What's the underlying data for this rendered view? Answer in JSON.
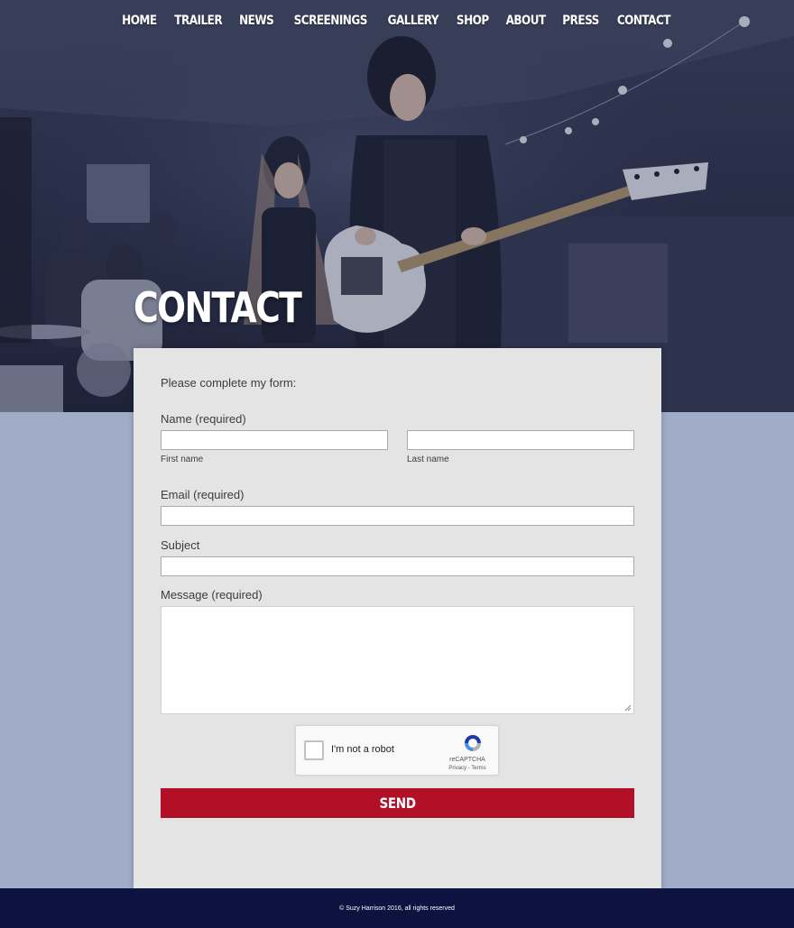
{
  "nav": {
    "items": [
      "HOME",
      "TRAILER",
      "NEWS",
      "SCREENINGS",
      "GALLERY",
      "SHOP",
      "ABOUT",
      "PRESS",
      "CONTACT"
    ]
  },
  "hero": {
    "title": "CONTACT"
  },
  "form": {
    "intro": "Please complete my form:",
    "name_label": "Name (required)",
    "first_name_label": "First name",
    "last_name_label": "Last name",
    "first_name_value": "",
    "last_name_value": "",
    "email_label": "Email (required)",
    "email_value": "",
    "subject_label": "Subject",
    "subject_value": "",
    "message_label": "Message (required)",
    "message_value": "",
    "send_label": "SEND"
  },
  "captcha": {
    "label": "I'm not a robot",
    "brand": "reCAPTCHA",
    "links": "Privacy - Terms"
  },
  "footer": {
    "text": "© Suzy Harrison 2016, all rights reserved"
  },
  "colors": {
    "hero_tint": "#262b40",
    "page_background": "#a1acc8",
    "panel_background": "#e4e4e4",
    "send_button": "#b21027",
    "footer_background": "#0d1340"
  }
}
